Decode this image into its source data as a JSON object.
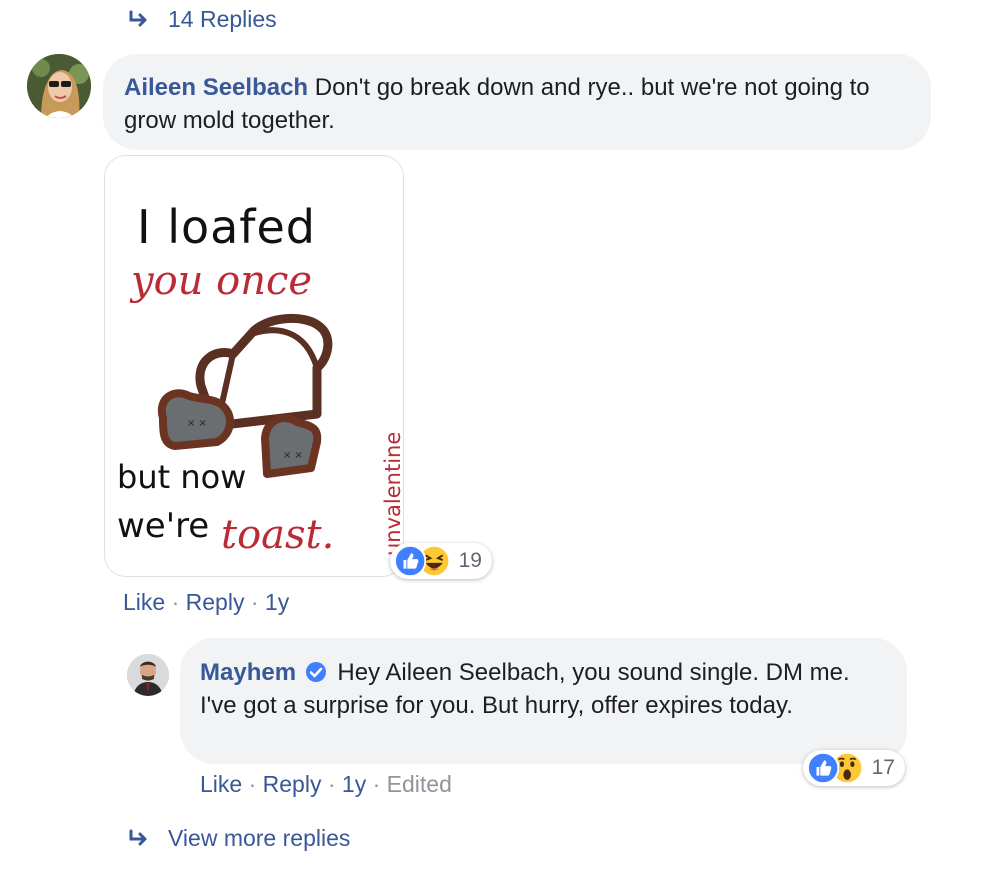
{
  "top_replies": {
    "label": "14 Replies"
  },
  "comment": {
    "author": "Aileen Seelbach",
    "text": "Don't go break down and rye.. but we're not going to grow mold together.",
    "image": {
      "line1": "I loafed",
      "line2": "you once",
      "line3": "but now",
      "line4": "we're",
      "line5": "toast.",
      "side_text": "unvalentine"
    },
    "reactions": {
      "icons": [
        "like-icon",
        "haha-icon"
      ],
      "count": "19"
    },
    "actions": {
      "like": "Like",
      "reply": "Reply",
      "time": "1y"
    }
  },
  "reply": {
    "author": "Mayhem",
    "verified": true,
    "text": "Hey Aileen Seelbach, you sound single. DM me. I've got a surprise for you. But hurry, offer expires today.",
    "reactions": {
      "icons": [
        "like-icon",
        "wow-icon"
      ],
      "count": "17"
    },
    "actions": {
      "like": "Like",
      "reply": "Reply",
      "time": "1y",
      "edited": "Edited"
    }
  },
  "view_more": {
    "label": "View more replies"
  },
  "colors": {
    "link": "#385898",
    "bubble": "#f2f3f5",
    "like_blue": "#4080ff",
    "emoji_yellow": "#fcc934",
    "toast_red": "#b92b35"
  }
}
